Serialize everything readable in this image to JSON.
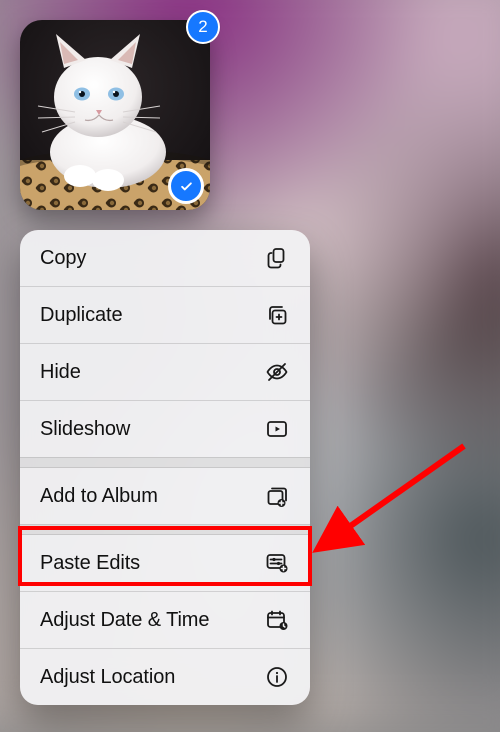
{
  "thumbnail": {
    "count": "2",
    "selected": true
  },
  "menu": {
    "groups": [
      [
        {
          "name": "copy",
          "label": "Copy",
          "icon": "copy-icon"
        },
        {
          "name": "duplicate",
          "label": "Duplicate",
          "icon": "duplicate-icon"
        },
        {
          "name": "hide",
          "label": "Hide",
          "icon": "eye-slash-icon"
        },
        {
          "name": "slideshow",
          "label": "Slideshow",
          "icon": "play-rect-icon"
        }
      ],
      [
        {
          "name": "add-to-album",
          "label": "Add to Album",
          "icon": "album-add-icon"
        }
      ],
      [
        {
          "name": "paste-edits",
          "label": "Paste Edits",
          "icon": "sliders-plus-icon",
          "highlighted": true
        },
        {
          "name": "adjust-date-time",
          "label": "Adjust Date & Time",
          "icon": "calendar-clock-icon"
        },
        {
          "name": "adjust-location",
          "label": "Adjust Location",
          "icon": "info-circle-icon"
        }
      ]
    ]
  },
  "annotations": {
    "arrow_color": "#ff0000",
    "highlight_color": "#ff0000"
  }
}
